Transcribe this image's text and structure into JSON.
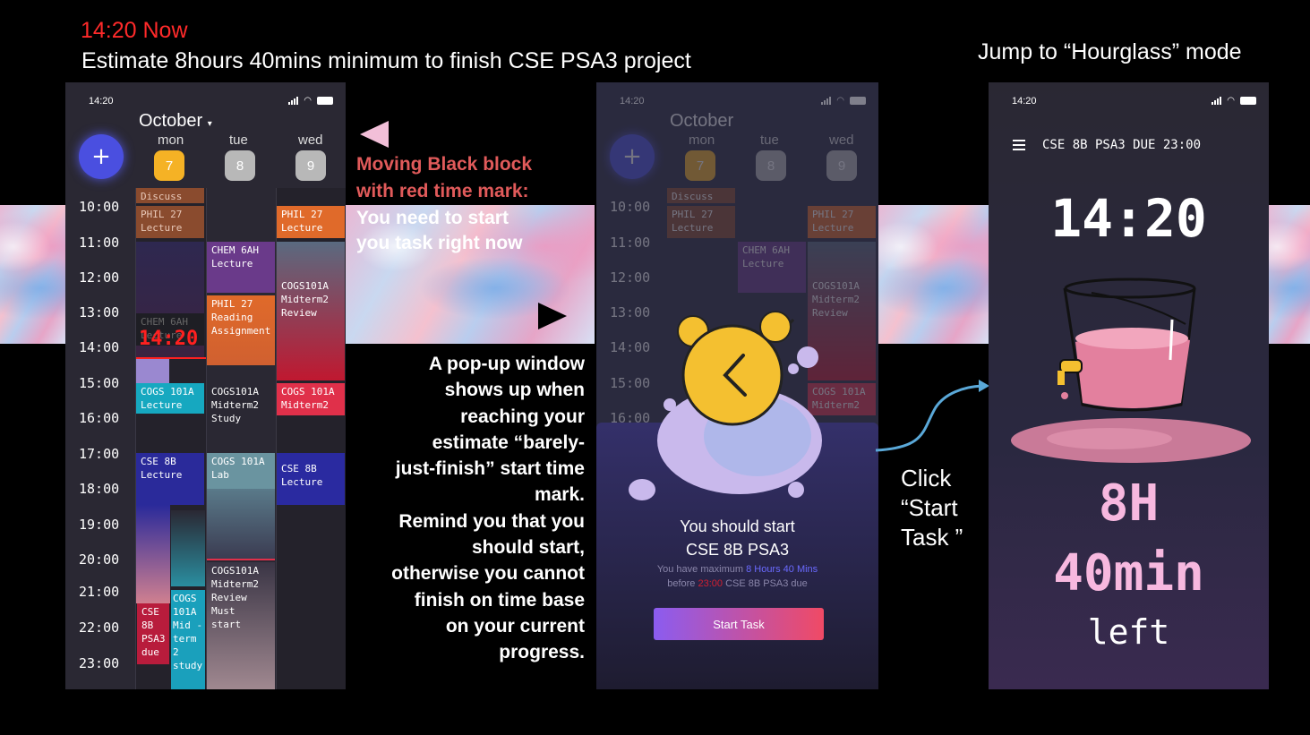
{
  "header": {
    "now": "14:20 Now",
    "estimate": "Estimate 8hours 40mins minimum to finish  CSE PSA3 project",
    "jump": "Jump to “Hourglass” mode"
  },
  "status_time": "14:20",
  "calendar": {
    "month": "October",
    "days": [
      {
        "name": "mon",
        "num": "7",
        "color": "#f5b225"
      },
      {
        "name": "tue",
        "num": "8",
        "color": "#b8b8b8"
      },
      {
        "name": "wed",
        "num": "9",
        "color": "#b8b8b8"
      }
    ],
    "add_label": "+",
    "hours": [
      "10:00",
      "11:00",
      "12:00",
      "13:00",
      "14:00",
      "15:00",
      "16:00",
      "17:00",
      "18:00",
      "19:00",
      "20:00",
      "21:00",
      "22:00",
      "23:00"
    ],
    "now_marker": "14:20",
    "events": {
      "discuss": "Discuss",
      "phil_mon": "PHIL 27 Lecture",
      "chem_mon": "CHEM 6AH Lecture",
      "cogs_mon": "COGS 101A Lecture",
      "cse_mon": "CSE 8B Lecture",
      "psa3_due": "CSE 8B PSA3 due",
      "cogs_mid_study": "COGS 101A Mid -term 2 study",
      "chem_tue": "CHEM 6AH Lecture",
      "phil_read": "PHIL 27 Reading Assignment",
      "cogs_mid2_study": "COGS101A Midterm2 Study",
      "cogs_lab": "COGS 101A Lab",
      "cogs_review_must": "COGS101A Midterm2 Review Must start",
      "phil_wed": "PHIL 27 Lecture",
      "cogs_review_wed": "COGS101A Midterm2 Review",
      "cogs_mid2_wed": "COGS 101A Midterm2",
      "cse_wed": "CSE 8B Lecture"
    }
  },
  "annotation1": {
    "line1": "Moving Black block",
    "line2": "with red time mark:",
    "line3": "You need to start",
    "line4": "you task right now"
  },
  "annotation2": {
    "lines": [
      "A pop-up window",
      "shows up when",
      "reaching your",
      "estimate “barely-",
      "just-finish” start time",
      "mark.",
      "Remind you that you",
      "should start,",
      "otherwise you cannot",
      "finish on time base",
      "on your current",
      "progress."
    ]
  },
  "popup": {
    "title1": "You should start",
    "title2": "CSE 8B PSA3",
    "sub_pre": "You have maximum",
    "sub_hours": "8 Hours 40 Mins",
    "sub_before": "before",
    "sub_time": "23:00",
    "sub_post": "CSE 8B PSA3 due",
    "button": "Start Task"
  },
  "click_note": {
    "line1": "Click",
    "line2": "“Start",
    "line3": "Task ”"
  },
  "hourglass": {
    "title": "CSE 8B PSA3 DUE 23:00",
    "clock": "14:20",
    "hours": "8H",
    "mins": "40min",
    "left": "left"
  },
  "colors": {
    "accent": "#4a4fe0",
    "red": "#ff2a2a",
    "pink": "#f7b8df",
    "annotation_red": "#e05a5a"
  }
}
